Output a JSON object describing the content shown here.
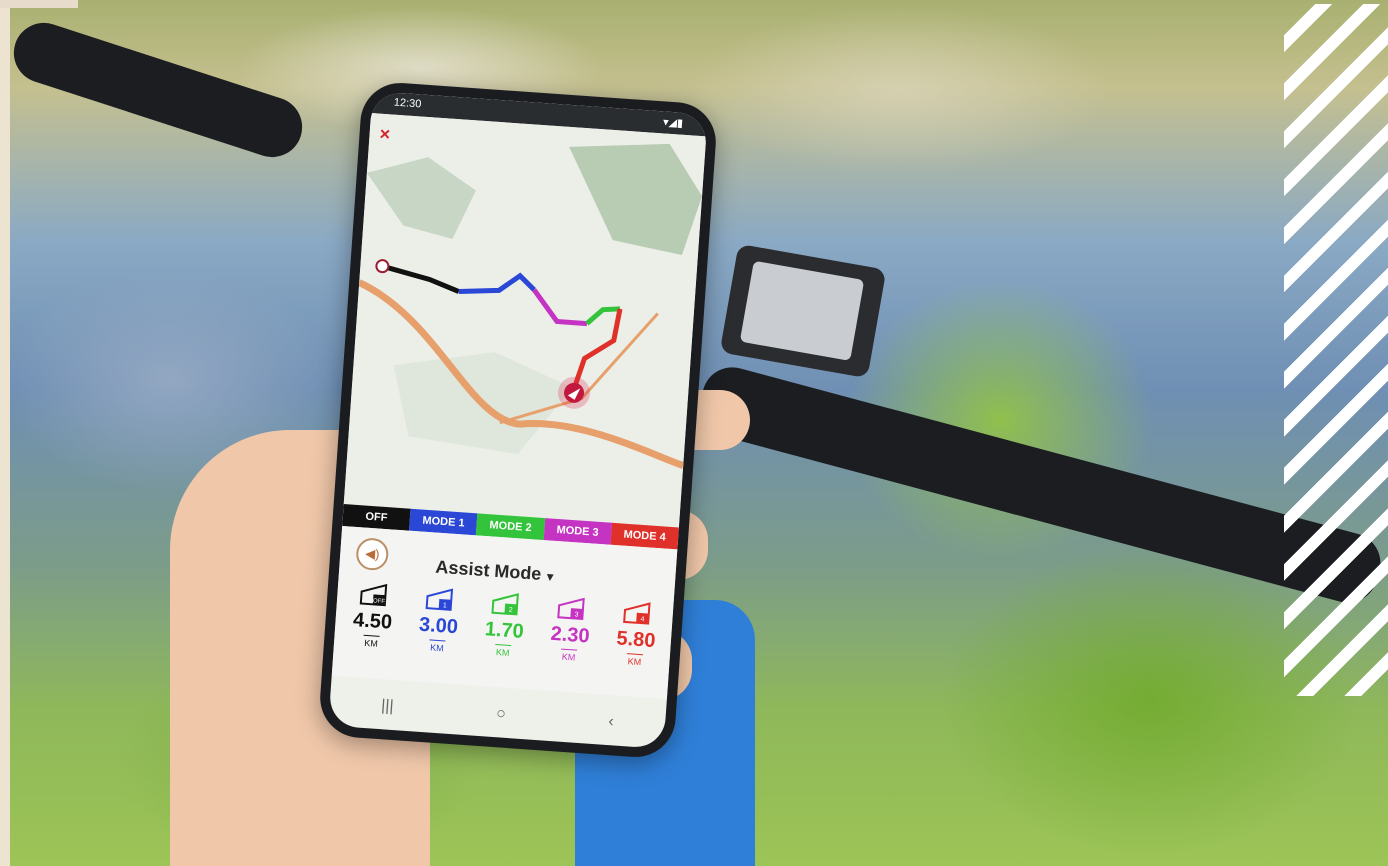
{
  "status_bar": {
    "time": "12:30",
    "icons": "▾◢▮"
  },
  "map": {
    "close_label": "×"
  },
  "legend": [
    {
      "label": "OFF",
      "color": "#111111"
    },
    {
      "label": "MODE 1",
      "color": "#2b47d6"
    },
    {
      "label": "MODE 2",
      "color": "#33c43b"
    },
    {
      "label": "MODE 3",
      "color": "#c533c2"
    },
    {
      "label": "MODE 4",
      "color": "#e0302a"
    }
  ],
  "assist": {
    "speaker_icon": "speaker-icon",
    "title": "Assist Mode",
    "caret": "▾"
  },
  "modes": [
    {
      "level": "OFF",
      "value": "4.50",
      "unit": "KM",
      "color": "#111111"
    },
    {
      "level": "1",
      "value": "3.00",
      "unit": "KM",
      "color": "#2b47d6"
    },
    {
      "level": "2",
      "value": "1.70",
      "unit": "KM",
      "color": "#33c43b"
    },
    {
      "level": "3",
      "value": "2.30",
      "unit": "KM",
      "color": "#c533c2"
    },
    {
      "level": "4",
      "value": "5.80",
      "unit": "KM",
      "color": "#e0302a"
    }
  ],
  "navbar": {
    "recents": "|||",
    "home": "○",
    "back": "‹"
  }
}
